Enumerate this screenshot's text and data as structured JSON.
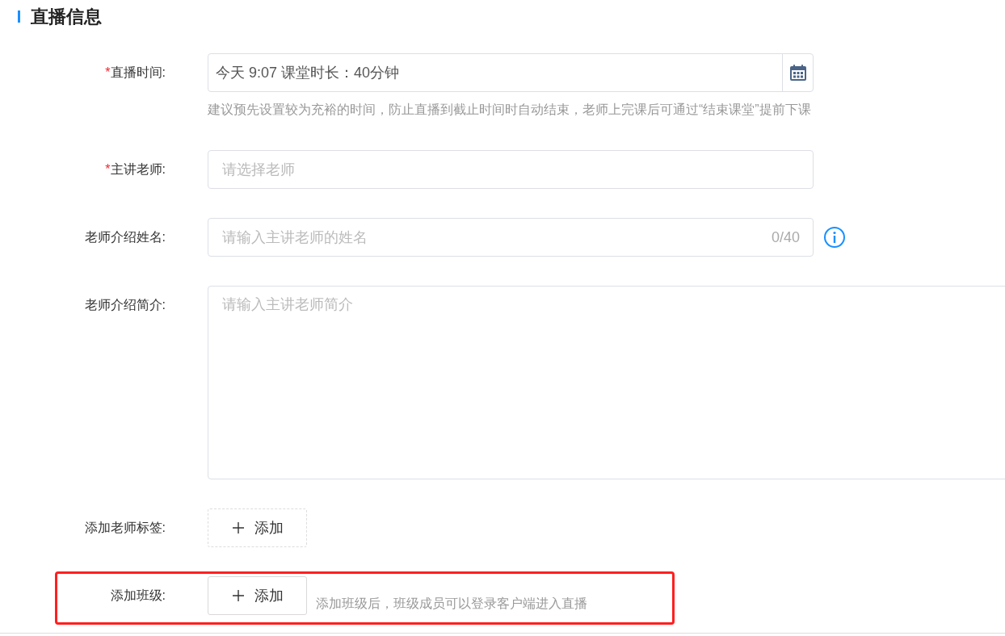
{
  "section_title": "直播信息",
  "fields": [
    {
      "kind": "datetime",
      "label": "直播时间:",
      "required_mark": "*",
      "value": "今天 9:07 课堂时长：40分钟",
      "hint": "建议预先设置较为充裕的时间，防止直播到截止时间时自动结束，老师上完课后可通过“结束课堂”提前下课"
    },
    {
      "kind": "select",
      "label": "主讲老师:",
      "required_mark": "*",
      "placeholder": "请选择老师"
    },
    {
      "kind": "counted",
      "label": "老师介绍姓名:",
      "placeholder": "请输入主讲老师的姓名",
      "counter": "0/40"
    },
    {
      "kind": "textarea",
      "label": "老师介绍简介:",
      "placeholder": "请输入主讲老师简介"
    },
    {
      "kind": "add",
      "label": "添加老师标签:",
      "button": "添加",
      "dashed": true
    },
    {
      "kind": "add",
      "label": "添加班级:",
      "button": "添加",
      "dashed": false,
      "highlighted": true,
      "note": "添加班级后，班级成员可以登录客户端进入直播"
    }
  ]
}
